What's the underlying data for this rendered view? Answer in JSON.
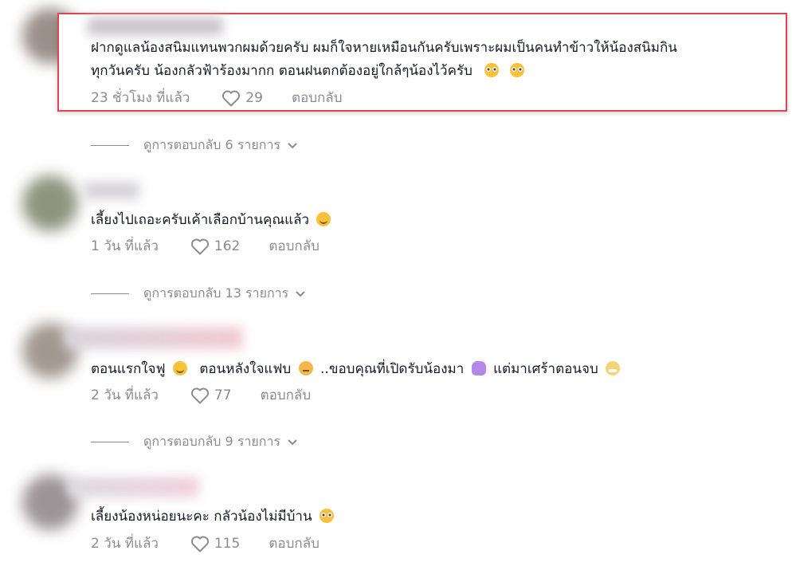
{
  "comments": [
    {
      "text_lines": [
        "ฝากดูแลน้องสนิมแทนพวกผมด้วยครับ ผมก็ใจหายเหมือนกันครับเพราะผมเป็นคนทำข้าวให้น้องสนิมกิน",
        "ทุกวันครับ น้องกลัวฟ้าร้องมากก ตอนฝนตกต้องอยู่ใกล้ๆน้องไว้ครับ"
      ],
      "emojis": [
        "pleading-face-emoji",
        "pleading-face-emoji"
      ],
      "time": "23 ชั่วโมง ที่แล้ว",
      "likes": "29",
      "reply_label": "ตอบกลับ",
      "view_replies": "ดูการตอบกลับ 6 รายการ"
    },
    {
      "text": "เลี้ยงไปเถอะครับเค้าเลือกบ้านคุณแล้ว",
      "emojis": [
        "smiling-face-emoji"
      ],
      "time": "1 วัน ที่แล้ว",
      "likes": "162",
      "reply_label": "ตอบกลับ",
      "view_replies": "ดูการตอบกลับ 13 รายการ"
    },
    {
      "text_parts": [
        "ตอนแรกใจฟู",
        "ตอนหลังใจแฟบ",
        "..ขอบคุณที่เปิดรับน้องมา",
        "แต่มาเศร้าตอนจบ"
      ],
      "emojis": [
        "smiling-face-emoji",
        "pensive-face-emoji",
        "folded-hands-emoji",
        "tired-face-emoji"
      ],
      "time": "2 วัน ที่แล้ว",
      "likes": "77",
      "reply_label": "ตอบกลับ",
      "view_replies": "ดูการตอบกลับ 9 รายการ"
    },
    {
      "text": "เลี้ยงน้องหน่อยนะคะ กลัวน้องไม่มีบ้าน",
      "emojis": [
        "pleading-face-emoji"
      ],
      "time": "2 วัน ที่แล้ว",
      "likes": "115",
      "reply_label": "ตอบกลับ"
    }
  ],
  "colors": {
    "highlight_border": "#e0464e",
    "muted_text": "#8a8b91",
    "primary_text": "#161823"
  }
}
